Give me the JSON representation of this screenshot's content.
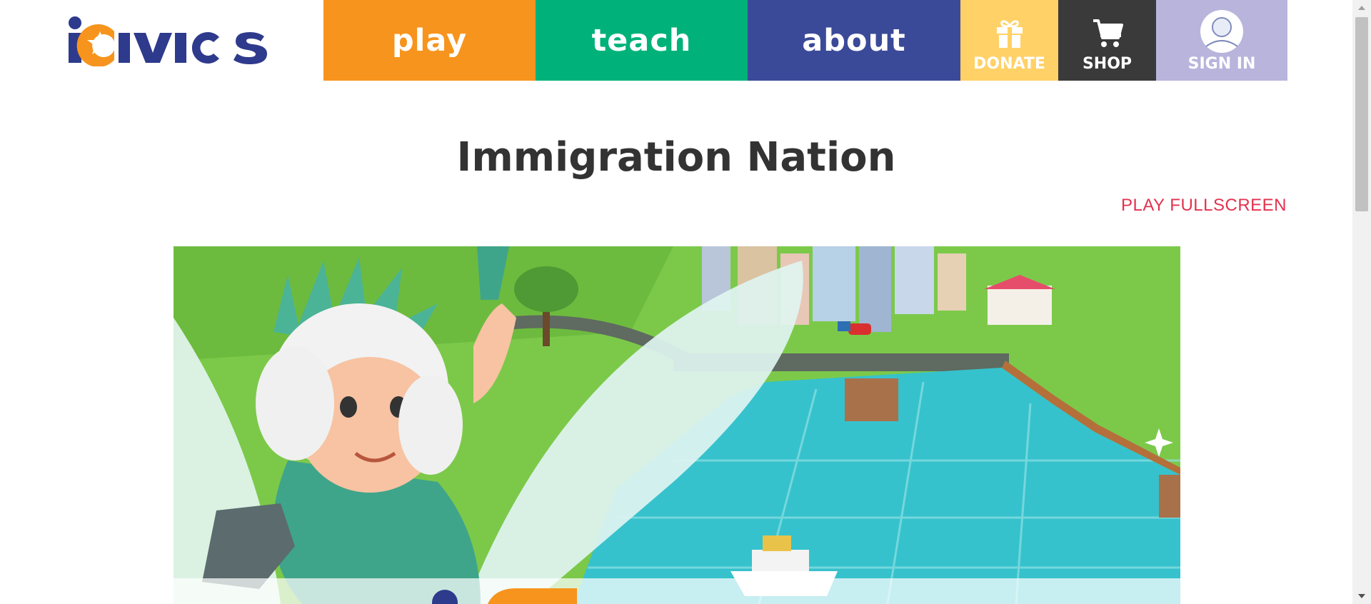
{
  "logo": {
    "text": "iCivics"
  },
  "nav": {
    "play": "play",
    "teach": "teach",
    "about": "about",
    "donate": "DONATE",
    "shop": "SHOP",
    "sign_in": "SIGN IN"
  },
  "page": {
    "title": "Immigration Nation",
    "fullscreen_link": "PLAY FULLSCREEN"
  },
  "colors": {
    "play": "#f7941d",
    "teach": "#00b27a",
    "about": "#3b4a98",
    "donate": "#ffd166",
    "shop": "#3a3a3a",
    "sign_in": "#b8b4dc",
    "link": "#e2324f"
  },
  "icons": [
    "gift-icon",
    "cart-icon",
    "user-avatar-icon",
    "logo-star-icon"
  ]
}
